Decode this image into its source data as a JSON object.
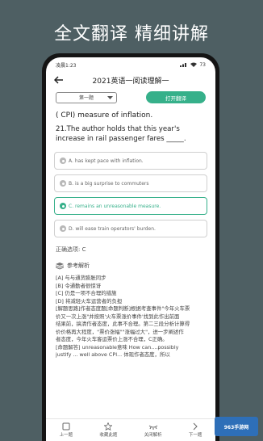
{
  "headline": "全文翻译 精细讲解",
  "status": {
    "time": "凌晨1:23",
    "battery": "73"
  },
  "nav": {
    "title": "2021英语一阅读理解一"
  },
  "controls": {
    "select_value": "第一题",
    "translate_label": "打开翻译"
  },
  "passage_tail": "( CPI) measure of inflation.",
  "question": {
    "number": "21.",
    "text": "The author holds that this year's increase in rail passenger fares _____."
  },
  "options": [
    {
      "letter": "A.",
      "text": "has kept pace with inflation."
    },
    {
      "letter": "B.",
      "text": "is a big surprise to commuters"
    },
    {
      "letter": "C.",
      "text": "remains an unreasonable measure."
    },
    {
      "letter": "D.",
      "text": "will ease train operators' burden."
    }
  ],
  "answer": {
    "label": "正确选项:",
    "value": "C"
  },
  "analysis": {
    "title": "参考解析",
    "lines": [
      "[A] 与与通货膨胀同步",
      "[B] 令通勤者很惊讶",
      "[C] 仍是一项不合理的措施",
      "[D] 将减轻火车运营者的负担",
      "[解题思路]作者态度题[命题判断]根据考查事件\"今年火车票",
      "价又一次上涨\"并按照'火车票涨价事件'找到此作出前面",
      "结果前，搞清作者态度，此事不合理。第二三段分析计算得",
      "价价格再大程度，\"票价涨幅\"\"涨幅过大\"，进一步阐述作",
      "者态度，今年火车客运票价上涨不合理，C正确。",
      "[命题解答] unreasonable意味 How can....possibly",
      "justify ... well above CPI... 体现作者态度，所以"
    ]
  },
  "bottom_tabs": [
    {
      "icon": "list-icon",
      "label": "上一题"
    },
    {
      "icon": "star-icon",
      "label": "收藏此题"
    },
    {
      "icon": "eye-off-icon",
      "label": "关闭解析"
    },
    {
      "icon": "next-icon",
      "label": "下一题"
    }
  ],
  "watermark": "963手游网"
}
